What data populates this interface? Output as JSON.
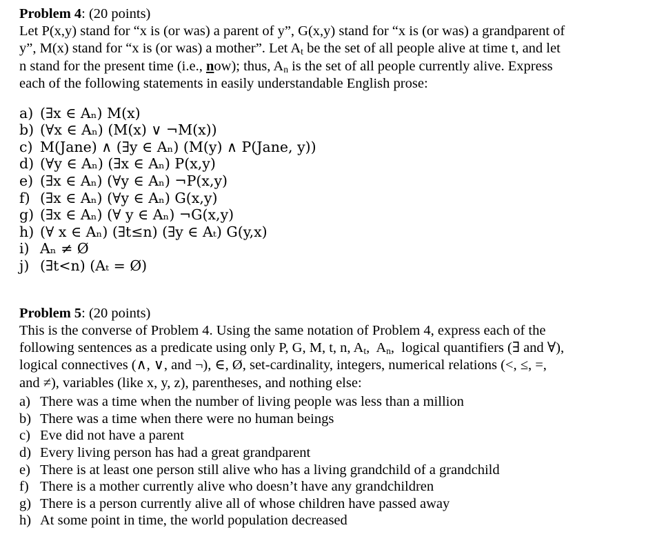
{
  "document": {
    "problem4": {
      "heading_label": "Problem 4",
      "heading_points": ": (20 points)",
      "intro_line1": "Let P(x,y) stand for “x is (or was) a parent of y”, G(x,y) stand for “x is (or was) a grandparent of",
      "intro_line2_a": "y”, M(x) stand for “x is (or was) a mother”. Let A",
      "intro_line2_sub": "t",
      "intro_line2_b": " be the set of all people alive at time t, and let",
      "intro_line3_a": "n stand for the present time (i.e., ",
      "intro_line3_underline": "n",
      "intro_line3_b": "ow); thus, A",
      "intro_line3_sub": "n",
      "intro_line3_c": " is the set of all people currently alive. Express",
      "intro_line4": "each of the following statements in easily understandable English prose:",
      "items": [
        {
          "mark": "a)",
          "text": "(∃x ∈ Aₙ) M(x)"
        },
        {
          "mark": "b)",
          "text": "(∀x ∈ Aₙ) (M(x) ∨ ¬M(x))"
        },
        {
          "mark": "c)",
          "text": "M(Jane) ∧ (∃y ∈ Aₙ) (M(y) ∧ P(Jane, y))"
        },
        {
          "mark": "d)",
          "text": "(∀y ∈ Aₙ) (∃x ∈ Aₙ) P(x,y)"
        },
        {
          "mark": "e)",
          "text": "(∃x ∈ Aₙ) (∀y ∈ Aₙ) ¬P(x,y)"
        },
        {
          "mark": "f)",
          "text": "(∃x ∈ Aₙ) (∀y ∈ Aₙ) G(x,y)"
        },
        {
          "mark": "g)",
          "text": "(∃x ∈ Aₙ) (∀ y ∈ Aₙ) ¬G(x,y)"
        },
        {
          "mark": "h)",
          "text": "(∀ x ∈ Aₙ) (∃t≤n) (∃y ∈ Aₜ) G(y,x)"
        },
        {
          "mark": "i)",
          "text": "Aₙ ≠ Ø"
        },
        {
          "mark": "j)",
          "text": "(∃t<n) (Aₜ = Ø)"
        }
      ]
    },
    "problem5": {
      "heading_label": "Problem 5",
      "heading_points": ": (20 points)",
      "intro_line1": "This is the converse of Problem 4. Using the same notation of Problem 4, express each of the",
      "intro_line2_a": "following sentences as a predicate using only P, G, M, t, n, A",
      "intro_line2_sub1": "t",
      "intro_line2_b": ",  A",
      "intro_line2_sub2": "n",
      "intro_line2_c": ",  logical quantifiers (∃ and ∀),",
      "intro_line3": "logical connectives (∧, ∨, and ¬), ∈, Ø, set-cardinality, integers, numerical relations (<, ≤, =,",
      "intro_line4": "and ≠), variables (like x, y, z), parentheses, and nothing else:",
      "items": [
        {
          "mark": "a)",
          "text": "There was a time when the number of living people was less than a million"
        },
        {
          "mark": "b)",
          "text": "There was a time when there were no human beings"
        },
        {
          "mark": "c)",
          "text": "Eve did not have a parent"
        },
        {
          "mark": "d)",
          "text": "Every living person has had a great grandparent"
        },
        {
          "mark": "e)",
          "text": "There is at least one person still alive who has a living grandchild of a grandchild"
        },
        {
          "mark": "f)",
          "text": "There is a mother currently alive who doesn’t have any grandchildren"
        },
        {
          "mark": "g)",
          "text": "There is a person currently alive all of whose children have passed away"
        },
        {
          "mark": "h)",
          "text": "At some point in time, the world population decreased"
        }
      ]
    }
  }
}
